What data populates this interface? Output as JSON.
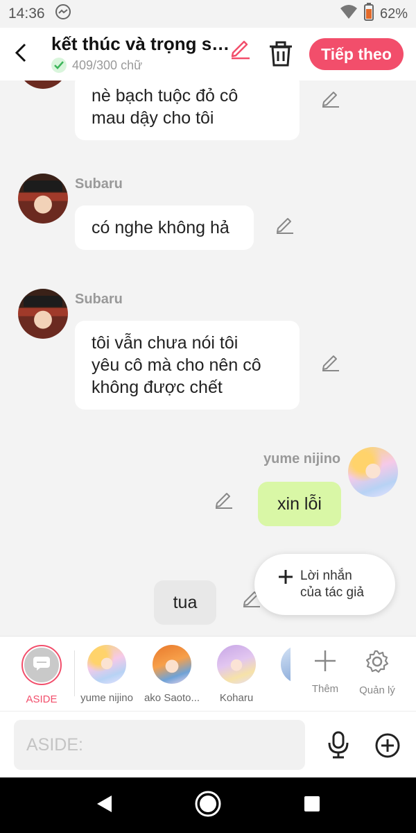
{
  "status_bar": {
    "time": "14:36",
    "battery": "62%"
  },
  "header": {
    "title": "kết thúc và trọng si...",
    "word_count": "409/300 chữ",
    "next_label": "Tiếp theo"
  },
  "messages": [
    {
      "sender": "",
      "text_lines": [
        "nè bạch tuộc đỏ cô",
        "mau dậy cho tôi"
      ]
    },
    {
      "sender": "Subaru",
      "text_lines": [
        "có nghe không hả"
      ]
    },
    {
      "sender": "Subaru",
      "text_lines": [
        "tôi vẫn chưa nói tôi",
        "yêu cô mà cho nên cô",
        "không được chết"
      ]
    },
    {
      "sender": "yume nijino",
      "text_lines": [
        "xin lỗi"
      ]
    },
    {
      "sender": "",
      "text_lines": [
        "tua"
      ]
    }
  ],
  "author_popup": {
    "line1": "Lời nhắn",
    "line2": "của tác giả"
  },
  "char_bar": {
    "items": [
      {
        "label": "ASIDE"
      },
      {
        "label": "yume nijino"
      },
      {
        "label": "ako Saoto..."
      },
      {
        "label": "Koharu"
      },
      {
        "label": ""
      }
    ],
    "add_label": "Thêm",
    "manage_label": "Quản lý"
  },
  "input": {
    "placeholder": "ASIDE:"
  },
  "colors": {
    "accent": "#f24e6b",
    "green_bubble": "#d9f7a6",
    "background": "#f3f3f3"
  },
  "icons": [
    "messenger-icon",
    "wifi-icon",
    "battery-icon",
    "back-arrow-icon",
    "edit-pencil-icon",
    "trash-icon",
    "check-icon",
    "plus-icon",
    "gear-icon",
    "microphone-icon",
    "add-circle-icon",
    "nav-back-icon",
    "nav-home-icon",
    "nav-recents-icon"
  ]
}
